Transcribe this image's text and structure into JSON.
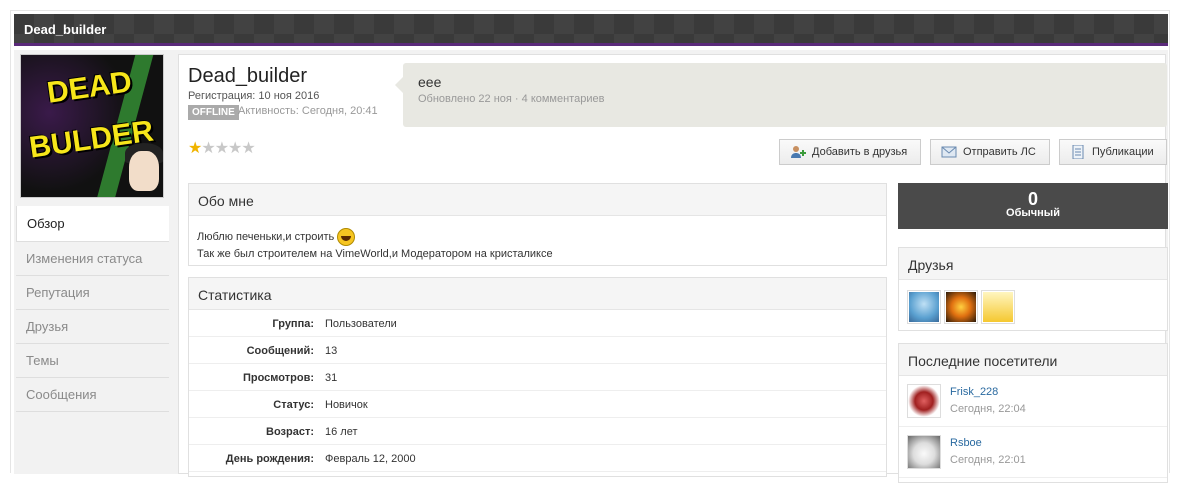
{
  "window": {
    "title": "Dead_builder"
  },
  "avatar": {
    "line1": "DEAD",
    "line2": "BULDER"
  },
  "nav": [
    {
      "label": "Обзор",
      "active": true
    },
    {
      "label": "Изменения статуса",
      "active": false
    },
    {
      "label": "Репутация",
      "active": false
    },
    {
      "label": "Друзья",
      "active": false
    },
    {
      "label": "Темы",
      "active": false
    },
    {
      "label": "Сообщения",
      "active": false
    }
  ],
  "profile": {
    "name": "Dead_builder",
    "registered": "Регистрация: 10 ноя 2016",
    "online_badge": "OFFLINE",
    "activity": "Активность: Сегодня, 20:41",
    "rating_stars": 1,
    "rating_max": 5
  },
  "status": {
    "text": "еее",
    "meta": "Обновлено 22 ноя · 4 комментариев"
  },
  "buttons": {
    "add_friend": "Добавить в друзья",
    "send_pm": "Отправить ЛС",
    "publications": "Публикации"
  },
  "about": {
    "title": "Обо мне",
    "line1": "Люблю печеньки,и строить",
    "line2": "Так же был строителем на VimeWorld,и Модератором на кристаликсе"
  },
  "stats": {
    "title": "Статистика",
    "rows": [
      {
        "key": "Группа:",
        "value": "Пользователи"
      },
      {
        "key": "Сообщений:",
        "value": "13"
      },
      {
        "key": "Просмотров:",
        "value": "31"
      },
      {
        "key": "Статус:",
        "value": "Новичок"
      },
      {
        "key": "Возраст:",
        "value": "16 лет"
      },
      {
        "key": "День рождения:",
        "value": "Февраль 12, 2000"
      }
    ]
  },
  "reputation": {
    "value": "0",
    "label": "Обычный"
  },
  "friends": {
    "title": "Друзья"
  },
  "visitors": {
    "title": "Последние посетители",
    "items": [
      {
        "name": "Frisk_228",
        "time": "Сегодня, 22:04"
      },
      {
        "name": "Rsboe",
        "time": "Сегодня, 22:01"
      }
    ]
  },
  "colors": {
    "accent_bar": "#5a2a7a",
    "rating_star": "#f0b400",
    "link": "#2a6aa0"
  }
}
